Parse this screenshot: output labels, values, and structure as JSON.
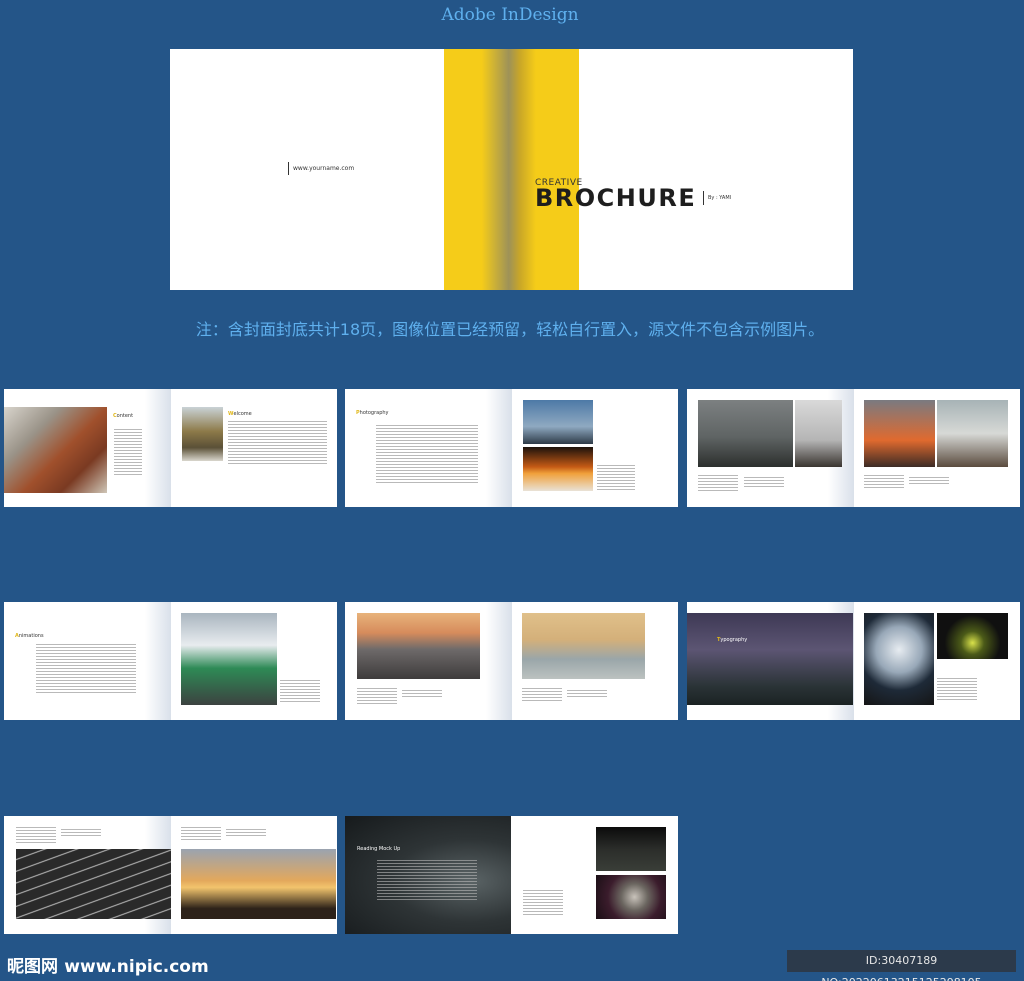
{
  "header": {
    "title": "Adobe InDesign"
  },
  "cover": {
    "url_text": "www.yourname.com",
    "creative": "CREATIVE",
    "brochure": "BROCHURE",
    "by": "By : YAMI",
    "stripe_color": "#f5cc19"
  },
  "note": "注：含封面封底共计18页，图像位置已经预留，轻松自行置入，源文件不包含示例图片。",
  "spreads": [
    {
      "heading_initial": "C",
      "heading_rest": "ontent",
      "right_heading_initial": "W",
      "right_heading_rest": "elcome"
    },
    {
      "heading_initial": "P",
      "heading_rest": "hotography"
    },
    {},
    {
      "heading_initial": "A",
      "heading_rest": "nimations"
    },
    {},
    {
      "heading_initial": "T",
      "heading_rest": "ypography"
    },
    {},
    {
      "heading_initial": "",
      "heading_rest": "Reading Mock Up"
    }
  ],
  "footer": {
    "watermark_logo": "昵图网",
    "watermark_url": "www.nipic.com",
    "id_text": "ID:30407189 NO:20220613215125298105"
  },
  "colors": {
    "background": "#245588",
    "accent_text": "#5fb0ee",
    "yellow": "#f5cc19"
  }
}
